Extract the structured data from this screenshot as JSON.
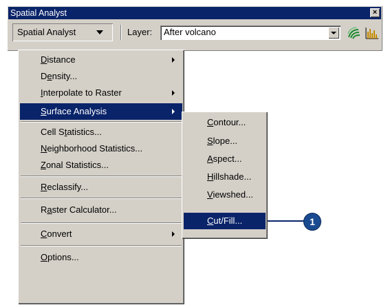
{
  "toolbar": {
    "title": "Spatial Analyst",
    "close_glyph": "×",
    "menu_button": "Spatial Analyst",
    "layer_label": "Layer:",
    "layer_value": "After volcano",
    "icons": [
      "contour-tool-icon",
      "histogram-icon"
    ]
  },
  "main_menu": {
    "items": [
      {
        "pre": "",
        "u": "D",
        "post": "istance",
        "submenu": true
      },
      {
        "pre": "D",
        "u": "e",
        "post": "nsity...",
        "submenu": false
      },
      {
        "pre": "",
        "u": "I",
        "post": "nterpolate to Raster",
        "submenu": true
      },
      {
        "pre": "",
        "u": "S",
        "post": "urface Analysis",
        "submenu": true,
        "selected": true
      },
      {
        "pre": "Cell S",
        "u": "t",
        "post": "atistics...",
        "submenu": false
      },
      {
        "pre": "",
        "u": "N",
        "post": "eighborhood Statistics...",
        "submenu": false
      },
      {
        "pre": "",
        "u": "Z",
        "post": "onal Statistics...",
        "submenu": false
      },
      {
        "pre": "",
        "u": "R",
        "post": "eclassify...",
        "submenu": false
      },
      {
        "pre": "R",
        "u": "a",
        "post": "ster Calculator...",
        "submenu": false
      },
      {
        "pre": "",
        "u": "C",
        "post": "onvert",
        "submenu": true
      },
      {
        "pre": "",
        "u": "O",
        "post": "ptions...",
        "submenu": false
      }
    ]
  },
  "sub_menu": {
    "items": [
      {
        "pre": "",
        "u": "C",
        "post": "ontour..."
      },
      {
        "pre": "",
        "u": "S",
        "post": "lope..."
      },
      {
        "pre": "",
        "u": "A",
        "post": "spect..."
      },
      {
        "pre": "",
        "u": "H",
        "post": "illshade..."
      },
      {
        "pre": "",
        "u": "V",
        "post": "iewshed..."
      },
      {
        "pre": "",
        "u": "C",
        "post": "ut/Fill...",
        "selected": true
      }
    ]
  },
  "callout": {
    "number": "1"
  },
  "colors": {
    "highlight": "#0a246a",
    "face": "#d4d0c8",
    "callout": "#1a4a8f"
  }
}
